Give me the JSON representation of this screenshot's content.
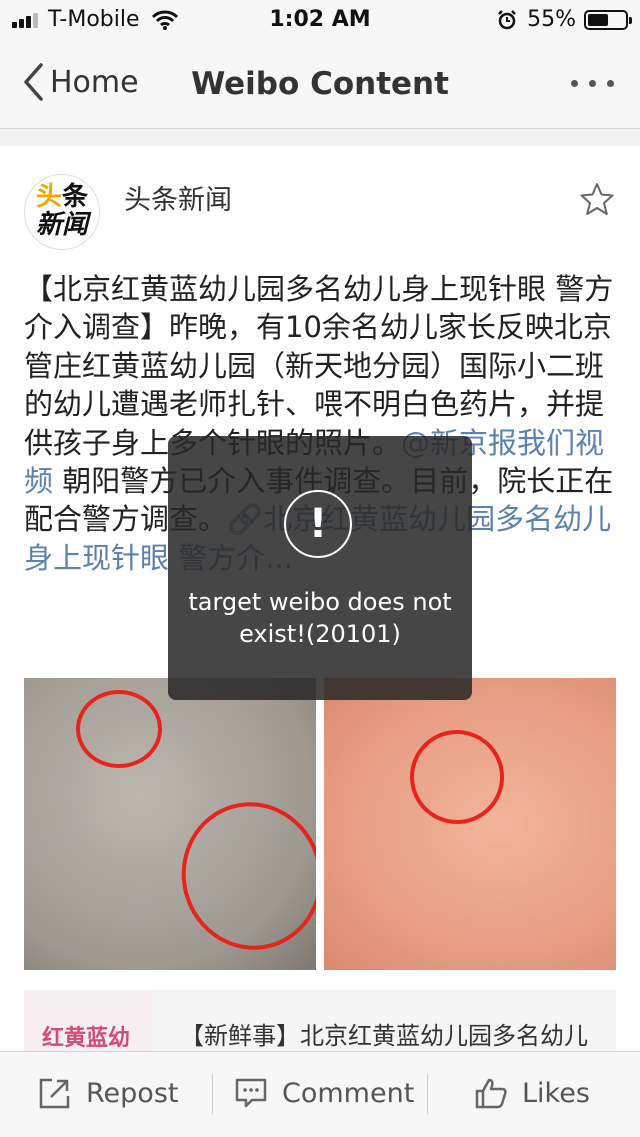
{
  "status_bar": {
    "carrier": "T-Mobile",
    "time": "1:02 AM",
    "battery": "55%",
    "battery_level": 0.55
  },
  "nav": {
    "back_label": "Home",
    "title": "Weibo Content"
  },
  "post": {
    "avatar_line1_a": "头",
    "avatar_line1_b": "条",
    "avatar_line2": "新闻",
    "author": "头条新闻",
    "text_before_mention": "【北京红黄蓝幼儿园多名幼儿身上现针眼 警方介入调查】昨晚，有10余名幼儿家长反映北京管庄红黄蓝幼儿园（新天地分园）国际小二班的幼儿遭遇老师扎针、喂不明白色药片，并提供孩子身上多个针眼的照片。",
    "mention": "@新京报我们视频",
    "text_after_mention": " 朝阳警方已介入事件调查。目前，院长正在配合警方调查。",
    "link": "🔗北京红黄蓝幼儿园多名幼儿身上现针眼 警方介...",
    "share_thumb_text": "红黄蓝幼",
    "share_title": "【新鲜事】北京红黄蓝幼儿园多名幼儿"
  },
  "toast": {
    "icon": "!",
    "message": "target weibo does not exist!(20101)"
  },
  "toolbar": {
    "repost": "Repost",
    "comment": "Comment",
    "likes": "Likes"
  }
}
